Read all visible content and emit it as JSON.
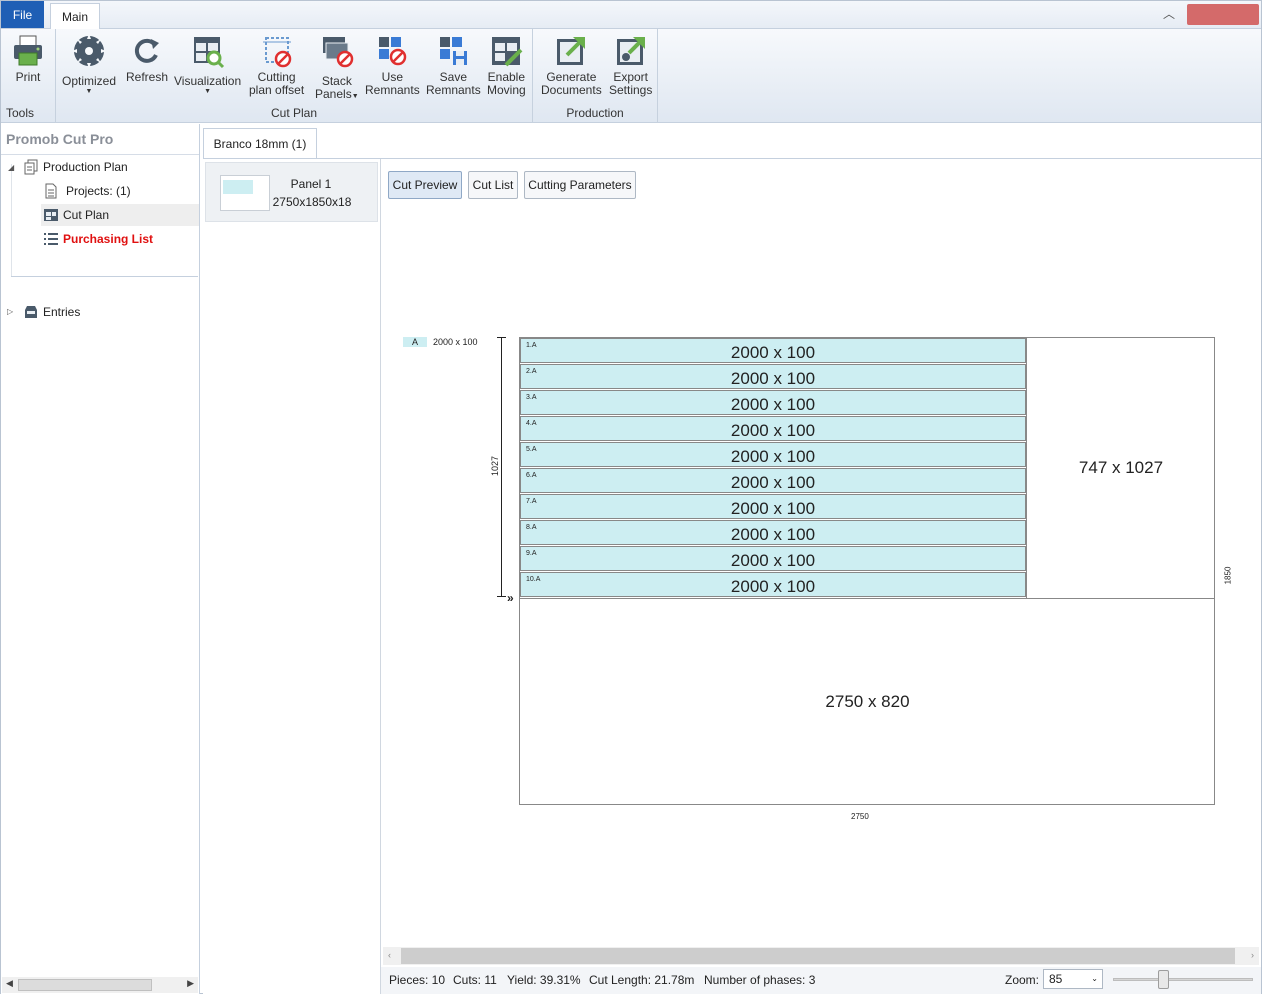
{
  "tabs": {
    "file": "File",
    "main": "Main"
  },
  "ribbon": {
    "tools": {
      "label": "Tools",
      "print": "Print"
    },
    "cut_plan": {
      "label": "Cut Plan",
      "optimized": "Optimized",
      "refresh": "Refresh",
      "visualization": "Visualization",
      "cutting_offset_1": "Cutting",
      "cutting_offset_2": "plan offset",
      "stack_1": "Stack",
      "stack_2": "Panels",
      "use_remnants_1": "Use",
      "use_remnants_2": "Remnants",
      "save_remnants_1": "Save",
      "save_remnants_2": "Remnants",
      "enable_moving_1": "Enable",
      "enable_moving_2": "Moving"
    },
    "production": {
      "label": "Production",
      "generate_1": "Generate",
      "generate_2": "Documents",
      "export_1": "Export",
      "export_2": "Settings"
    }
  },
  "nav": {
    "title": "Promob Cut Pro",
    "production_plan": "Production Plan",
    "projects": "Projects: (1)",
    "cut_plan": "Cut Plan",
    "purchasing_list": "Purchasing List",
    "entries": "Entries"
  },
  "material_tab": "Branco 18mm (1)",
  "panel": {
    "name": "Panel 1",
    "size": "2750x1850x18"
  },
  "subtabs": {
    "preview": "Cut Preview",
    "cut_list": "Cut List",
    "params": "Cutting Parameters"
  },
  "diagram": {
    "legend_badge": "A",
    "legend_text": "2000 x 100",
    "pieces": [
      {
        "id": "1.A",
        "dim": "2000 x 100"
      },
      {
        "id": "2.A",
        "dim": "2000 x 100"
      },
      {
        "id": "3.A",
        "dim": "2000 x 100"
      },
      {
        "id": "4.A",
        "dim": "2000 x 100"
      },
      {
        "id": "5.A",
        "dim": "2000 x 100"
      },
      {
        "id": "6.A",
        "dim": "2000 x 100"
      },
      {
        "id": "7.A",
        "dim": "2000 x 100"
      },
      {
        "id": "8.A",
        "dim": "2000 x 100"
      },
      {
        "id": "9.A",
        "dim": "2000 x 100"
      },
      {
        "id": "10.A",
        "dim": "2000 x 100"
      }
    ],
    "remnant_right": "747 x 1027",
    "remnant_bottom": "2750 x 820",
    "dim_vertical": "1027",
    "dim_width": "2750",
    "dim_height": "1850",
    "phase_marker": "»"
  },
  "status": {
    "pieces": "Pieces: 10",
    "cuts": "Cuts: 11",
    "yield": "Yield: 39.31%",
    "cut_length": "Cut Length: 21.78m",
    "phases": "Number of phases: 3",
    "zoom_label": "Zoom:",
    "zoom_value": "85"
  },
  "colors": {
    "file_tab": "#1f5fb5",
    "piece_fill": "#cdeef2",
    "close": "#d46a6a",
    "purchasing": "#e01010"
  }
}
